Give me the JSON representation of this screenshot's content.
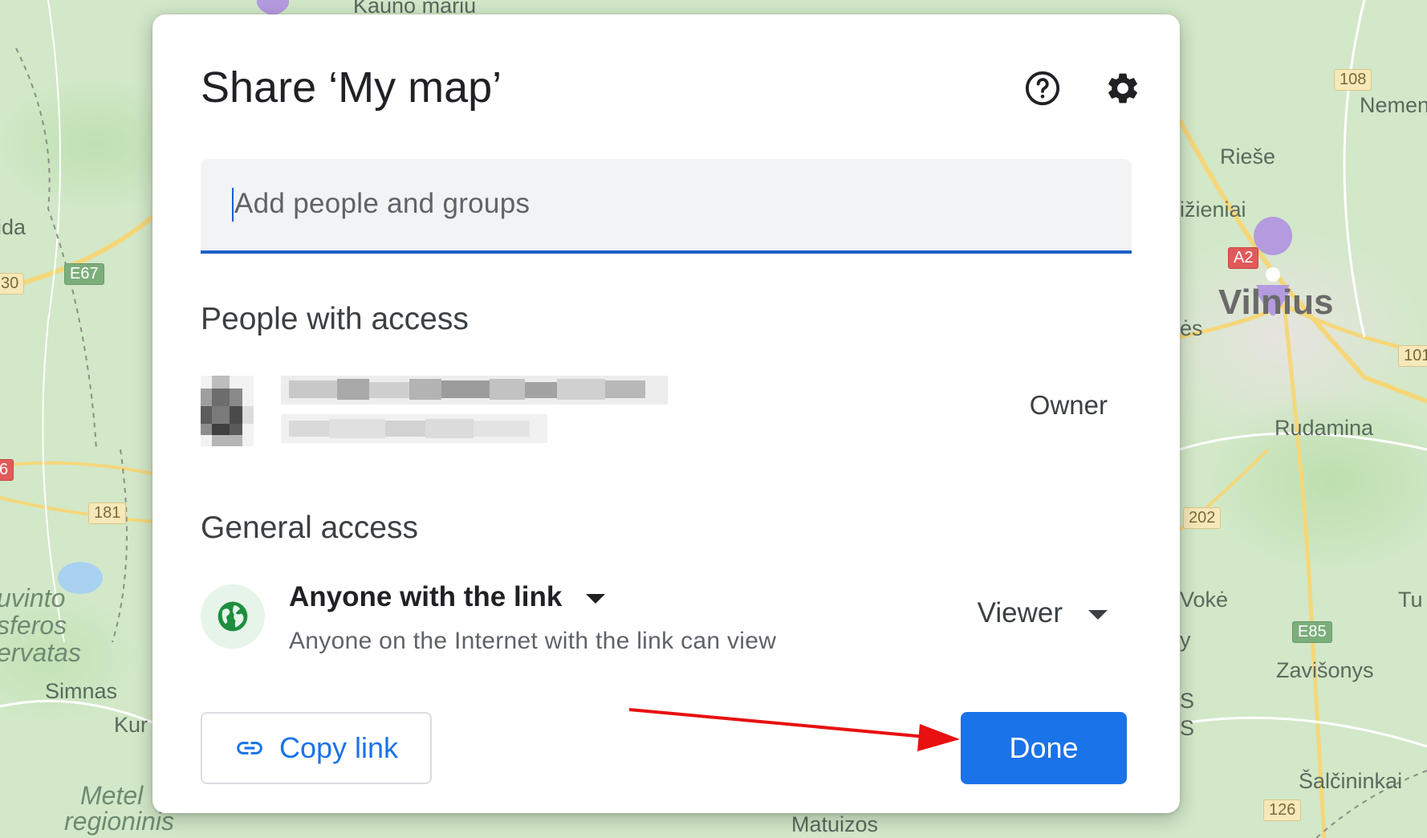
{
  "dialog": {
    "title": "Share ‘My map’",
    "add_people_placeholder": "Add people and groups",
    "people_section_title": "People with access",
    "person_role": "Owner",
    "general_section_title": "General access",
    "access_option": "Anyone with the link",
    "access_description": "Anyone on the Internet with the link can view",
    "permission": "Viewer",
    "copy_link_label": "Copy link",
    "done_label": "Done"
  },
  "icons": {
    "help": "help-circle-icon",
    "settings": "gear-icon",
    "globe": "globe-icon",
    "link": "link-icon"
  },
  "colors": {
    "accent": "#1a73e8",
    "field_underline": "#1a5fc8",
    "globe_bg": "#e6f4ea",
    "globe": "#1e8e3e",
    "annotation_arrow": "#e81010"
  },
  "map": {
    "labels": {
      "kauno": "Kauno mariu",
      "ida": "ida",
      "nemen": "Nemen",
      "riese": "Rieše",
      "vizieniai": "ižieniai",
      "vilnius": "Vilnius",
      "es": "ės",
      "rudamina": "Rudamina",
      "voke": "Vokė",
      "tu": "Tu",
      "zavisonys": "Zavišonys",
      "s1": "S",
      "s2": "S",
      "y": "y",
      "salcininkai": "Šalčininkai",
      "matuizos": "Matuizos",
      "simnas": "Simnas",
      "kur": "Kur",
      "uvinto": "uvinto",
      "sferos": "sferos",
      "ervatas": "ervatas",
      "metel": "Metel",
      "regioninis": "regioninis"
    },
    "badges": {
      "b108": "108",
      "a2": "A2",
      "b101": "101",
      "e67": "E67",
      "b30": "30",
      "b6": "6",
      "b181": "181",
      "b202": "202",
      "e85": "E85",
      "b126": "126"
    }
  }
}
